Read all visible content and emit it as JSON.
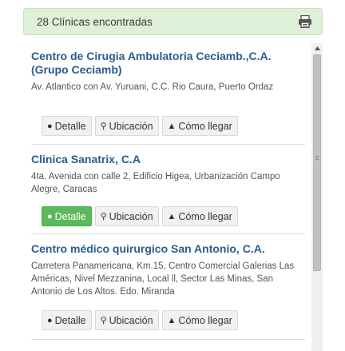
{
  "header": {
    "count_text": "28 Clínicas encontradas",
    "print_icon": "printer-icon"
  },
  "clinics": [
    {
      "name": "Centro de Cirugia Ambulatoria Ceciamb.,C.A. (Grupo Ceciamb)",
      "address": "Av. Atlantico con Av. Yuruani, C.C. Rio Caura, Puerto Ordaz",
      "detail_label": "Detalle",
      "location_label": "Ubicación",
      "directions_label": "Cómo llegar"
    },
    {
      "name": "Clinica Sanatrix, C.A",
      "address": "4ta. Avenida con calle 2, Edificio Higea, Urbanización Campo Alegre, Caracas",
      "detail_label": "Detalle",
      "location_label": "Ubicación",
      "directions_label": "Cómo llegar",
      "detail_active": true
    },
    {
      "name": "Centro médico quirurgico San Antonio, C.A.",
      "address": "Carretera Panamericana, Km.15, Centro Comercial Galerias Las Américas, Nivel Mezzanina, Local ll, Sector Las Minas, San Antonio de Los Altos. Edo. Miranda",
      "detail_label": "Detalle",
      "location_label": "Ubicación",
      "directions_label": "Cómo llegar"
    }
  ],
  "icons": {
    "detail": "info-circle-icon",
    "location": "map-marker-icon",
    "directions": "road-icon"
  },
  "colors": {
    "header_bg": "#dff0d8",
    "title": "#2b5d8c",
    "active_button": "#5cb85c"
  }
}
